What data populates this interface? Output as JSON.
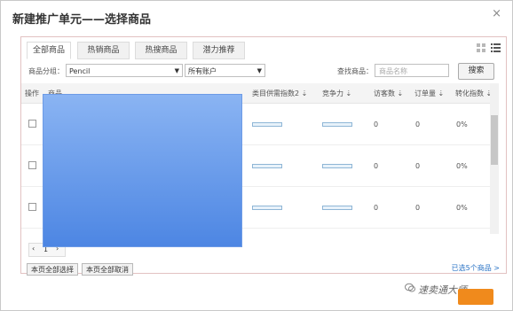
{
  "dialog": {
    "title": "新建推广单元——选择商品",
    "close": "×"
  },
  "tabs": [
    {
      "label": "全部商品",
      "active": true
    },
    {
      "label": "热销商品",
      "active": false
    },
    {
      "label": "热搜商品",
      "active": false
    },
    {
      "label": "潜力推荐",
      "active": false
    }
  ],
  "filters": {
    "group_label": "商品分组：",
    "group_value": "Pencil",
    "account_value": "所有账户",
    "search_label": "查找商品：",
    "search_placeholder": "商品名称",
    "search_button": "搜索"
  },
  "table": {
    "headers": [
      "操作",
      "商品",
      "类目供需指数2",
      "竞争力",
      "访客数",
      "订单量",
      "转化指数"
    ],
    "rows": [
      {
        "visitors": "0",
        "orders": "0",
        "conversion": "0%"
      },
      {
        "visitors": "0",
        "orders": "0",
        "conversion": "0%"
      },
      {
        "visitors": "0",
        "orders": "0",
        "conversion": "0%"
      }
    ]
  },
  "pager": {
    "page": "1"
  },
  "footer": {
    "select_all": "本页全部选择",
    "deselect_all": "本页全部取消",
    "selected_count": "已选5个商品 >"
  },
  "watermark": "速卖通大师",
  "colors": {
    "overlay_top": "#8ab4f3",
    "overlay_bottom": "#4d86e3",
    "accent": "#f08a1c",
    "link": "#2a73c5"
  }
}
